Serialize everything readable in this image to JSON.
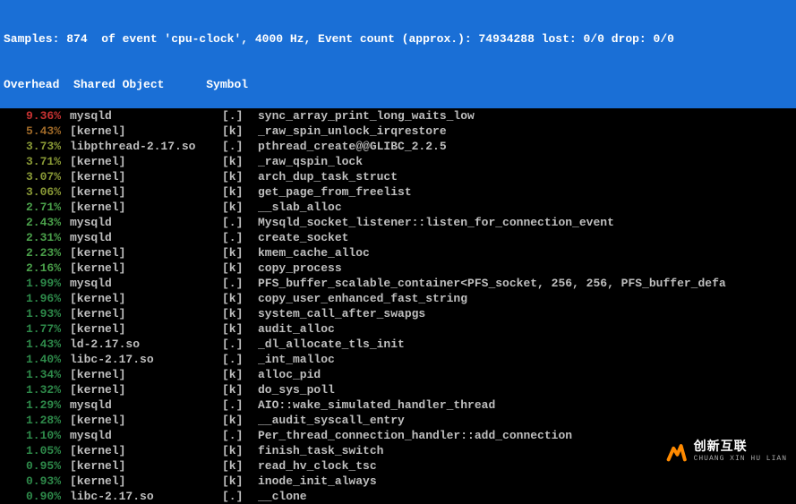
{
  "header": {
    "line1": "Samples: 874  of event 'cpu-clock', 4000 Hz, Event count (approx.): 74934288 lost: 0/0 drop: 0/0",
    "line2": "Overhead  Shared Object      Symbol"
  },
  "rows": [
    {
      "pct": "9.36%",
      "pclass": "c-red",
      "obj": "mysqld",
      "flag": "[.]",
      "sym": "sync_array_print_long_waits_low"
    },
    {
      "pct": "5.43%",
      "pclass": "c-brown",
      "obj": "[kernel]",
      "flag": "[k]",
      "sym": "_raw_spin_unlock_irqrestore"
    },
    {
      "pct": "3.73%",
      "pclass": "c-olive",
      "obj": "libpthread-2.17.so",
      "flag": "[.]",
      "sym": "pthread_create@@GLIBC_2.2.5"
    },
    {
      "pct": "3.71%",
      "pclass": "c-olive",
      "obj": "[kernel]",
      "flag": "[k]",
      "sym": "_raw_qspin_lock"
    },
    {
      "pct": "3.07%",
      "pclass": "c-olive",
      "obj": "[kernel]",
      "flag": "[k]",
      "sym": "arch_dup_task_struct"
    },
    {
      "pct": "3.06%",
      "pclass": "c-olive",
      "obj": "[kernel]",
      "flag": "[k]",
      "sym": "get_page_from_freelist"
    },
    {
      "pct": "2.71%",
      "pclass": "c-green",
      "obj": "[kernel]",
      "flag": "[k]",
      "sym": "__slab_alloc"
    },
    {
      "pct": "2.43%",
      "pclass": "c-green",
      "obj": "mysqld",
      "flag": "[.]",
      "sym": "Mysqld_socket_listener::listen_for_connection_event"
    },
    {
      "pct": "2.31%",
      "pclass": "c-green",
      "obj": "mysqld",
      "flag": "[.]",
      "sym": "create_socket"
    },
    {
      "pct": "2.23%",
      "pclass": "c-green",
      "obj": "[kernel]",
      "flag": "[k]",
      "sym": "kmem_cache_alloc"
    },
    {
      "pct": "2.16%",
      "pclass": "c-green",
      "obj": "[kernel]",
      "flag": "[k]",
      "sym": "copy_process"
    },
    {
      "pct": "1.99%",
      "pclass": "c-dgreen",
      "obj": "mysqld",
      "flag": "[.]",
      "sym": "PFS_buffer_scalable_container<PFS_socket, 256, 256, PFS_buffer_defa"
    },
    {
      "pct": "1.96%",
      "pclass": "c-dgreen",
      "obj": "[kernel]",
      "flag": "[k]",
      "sym": "copy_user_enhanced_fast_string"
    },
    {
      "pct": "1.93%",
      "pclass": "c-dgreen",
      "obj": "[kernel]",
      "flag": "[k]",
      "sym": "system_call_after_swapgs"
    },
    {
      "pct": "1.77%",
      "pclass": "c-dgreen",
      "obj": "[kernel]",
      "flag": "[k]",
      "sym": "audit_alloc"
    },
    {
      "pct": "1.43%",
      "pclass": "c-dgreen",
      "obj": "ld-2.17.so",
      "flag": "[.]",
      "sym": "_dl_allocate_tls_init"
    },
    {
      "pct": "1.40%",
      "pclass": "c-dgreen",
      "obj": "libc-2.17.so",
      "flag": "[.]",
      "sym": "_int_malloc"
    },
    {
      "pct": "1.34%",
      "pclass": "c-dgreen",
      "obj": "[kernel]",
      "flag": "[k]",
      "sym": "alloc_pid"
    },
    {
      "pct": "1.32%",
      "pclass": "c-dgreen",
      "obj": "[kernel]",
      "flag": "[k]",
      "sym": "do_sys_poll"
    },
    {
      "pct": "1.29%",
      "pclass": "c-dgreen",
      "obj": "mysqld",
      "flag": "[.]",
      "sym": "AIO::wake_simulated_handler_thread"
    },
    {
      "pct": "1.28%",
      "pclass": "c-dgreen",
      "obj": "[kernel]",
      "flag": "[k]",
      "sym": "__audit_syscall_entry"
    },
    {
      "pct": "1.10%",
      "pclass": "c-dgreen",
      "obj": "mysqld",
      "flag": "[.]",
      "sym": "Per_thread_connection_handler::add_connection"
    },
    {
      "pct": "1.05%",
      "pclass": "c-dgreen",
      "obj": "[kernel]",
      "flag": "[k]",
      "sym": "finish_task_switch"
    },
    {
      "pct": "0.95%",
      "pclass": "c-dgreen",
      "obj": "[kernel]",
      "flag": "[k]",
      "sym": "read_hv_clock_tsc"
    },
    {
      "pct": "0.93%",
      "pclass": "c-dgreen",
      "obj": "[kernel]",
      "flag": "[k]",
      "sym": "inode_init_always"
    },
    {
      "pct": "0.90%",
      "pclass": "c-dgreen",
      "obj": "libc-2.17.so",
      "flag": "[.]",
      "sym": "__clone"
    }
  ],
  "watermark": {
    "cn": "创新互联",
    "en": "CHUANG XIN HU LIAN"
  }
}
